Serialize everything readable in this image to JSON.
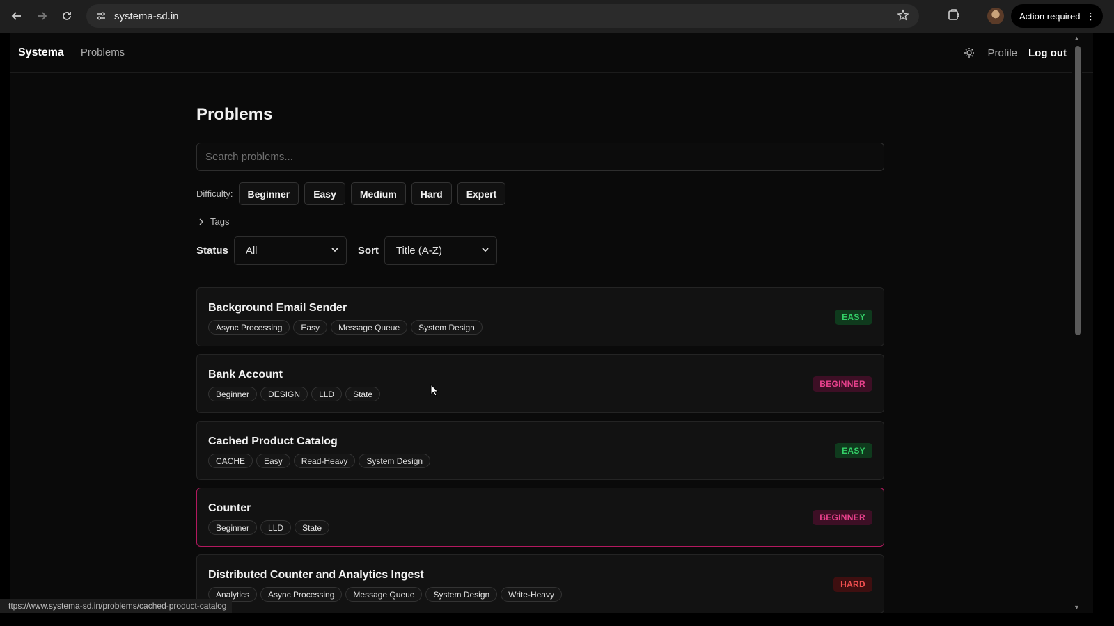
{
  "browser": {
    "url": "systema-sd.in",
    "action_required": "Action required",
    "status_url": "ttps://www.systema-sd.in/problems/cached-product-catalog"
  },
  "nav": {
    "brand": "Systema",
    "problems_link": "Problems",
    "profile_link": "Profile",
    "logout_link": "Log out"
  },
  "page": {
    "title": "Problems",
    "search_placeholder": "Search problems...",
    "difficulty_label": "Difficulty:",
    "difficulties": [
      "Beginner",
      "Easy",
      "Medium",
      "Hard",
      "Expert"
    ],
    "tags_label": "Tags",
    "status_label": "Status",
    "status_value": "All",
    "sort_label": "Sort",
    "sort_value": "Title (A-Z)"
  },
  "problems": [
    {
      "title": "Background Email Sender",
      "tags": [
        "Async Processing",
        "Easy",
        "Message Queue",
        "System Design"
      ],
      "difficulty": "EASY"
    },
    {
      "title": "Bank Account",
      "tags": [
        "Beginner",
        "DESIGN",
        "LLD",
        "State"
      ],
      "difficulty": "BEGINNER"
    },
    {
      "title": "Cached Product Catalog",
      "tags": [
        "CACHE",
        "Easy",
        "Read-Heavy",
        "System Design"
      ],
      "difficulty": "EASY"
    },
    {
      "title": "Counter",
      "tags": [
        "Beginner",
        "LLD",
        "State"
      ],
      "difficulty": "BEGINNER"
    },
    {
      "title": "Distributed Counter and Analytics Ingest",
      "tags": [
        "Analytics",
        "Async Processing",
        "Message Queue",
        "System Design",
        "Write-Heavy"
      ],
      "difficulty": "HARD"
    }
  ],
  "colors": {
    "easy": "#34d068",
    "beginner": "#e8418d",
    "hard": "#f04f4f",
    "active_border": "#b3195f"
  }
}
